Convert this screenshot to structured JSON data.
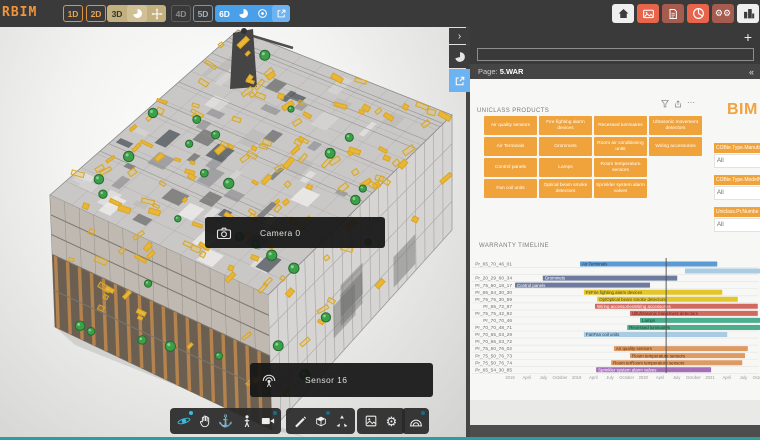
{
  "colors": {
    "accent_orange": "#F0A23B",
    "mode_blue": "#4AA0E8",
    "mode_tan": "#C3B07F",
    "hot_red": "#E8654C",
    "muted_red": "#A55C4E",
    "teal_bottom": "#2F9D9D",
    "active_tool_cyan": "#35BCE0"
  },
  "icons": {
    "plus": "+",
    "collapse": "«",
    "chevron_right": "›",
    "anchor": "⚓",
    "gear": "⚙",
    "more": "⋯"
  },
  "topbar": {
    "logo": "RBIM",
    "modes": {
      "d1": "1D",
      "d2": "2D",
      "d3": "3D",
      "d4": "4D",
      "d5": "5D",
      "d6": "6D"
    },
    "right_icons": [
      "home",
      "images",
      "document",
      "pie-chart",
      "gears",
      "building"
    ]
  },
  "viewport": {
    "tooltips": {
      "camera": "Camera 0",
      "sensor": "Sensor 16"
    },
    "toolbar_icons": [
      "orbit",
      "pan-hand",
      "anchor",
      "walk-person",
      "video-camera",
      "pencil-measure",
      "section-box",
      "explode-model",
      "saved-views",
      "settings-gear",
      "dome-view"
    ]
  },
  "panel": {
    "page_prefix": "Page:",
    "page_name": "5.WAR",
    "report": {
      "uniclass": {
        "title": "UNICLASS PRODUCTS",
        "rows": [
          [
            "Air quality sensors",
            "Fire fighting alarm devices",
            "Recessed luminaires",
            "Ultrasonic movement detectors"
          ],
          [
            "Air Terminals",
            "Grommets",
            "Room air conditioning units",
            "Wiring accessories"
          ],
          [
            "Control panels",
            "Lamps",
            "Room temperature sensors"
          ],
          [
            "Fan coil units",
            "Optical beam smoke detectors",
            "Sprinkler system alarm valves"
          ]
        ]
      },
      "logo": "BIM",
      "filters": [
        {
          "label": "COBie.Type.Manufa",
          "value": "All"
        },
        {
          "label": "COBie.Type.ModelN",
          "value": "All"
        },
        {
          "label": "Uniclass.Pr.Numbe",
          "value": "All"
        }
      ],
      "warranty": {
        "title": "WARRANTY TIMELINE",
        "axis_ticks": [
          "2018",
          "April",
          "July",
          "October",
          "2019",
          "April",
          "July",
          "October",
          "2020",
          "April",
          "July",
          "October",
          "2021",
          "April",
          "July",
          "October"
        ],
        "months_per_tick": 3,
        "today_month": 28.1,
        "rows": [
          {
            "id": "Pr_65_70_46_01",
            "label": "Air Terminals",
            "color": "#5b9bd5",
            "label_color": "#2c3e50",
            "start": 12.6,
            "end": 37.3
          },
          {
            "id": "",
            "label": "",
            "color": "#a9cce3",
            "label_color": "#2c3e50",
            "start": 31.5,
            "end": 45
          },
          {
            "id": "Pr_20_29_60_34",
            "label": "Grommets",
            "color": "#6e7b9e",
            "label_color": "#ffffff",
            "start": 5.9,
            "end": 30.1
          },
          {
            "id": "Pr_75_50_18_17",
            "label": "Control panels",
            "color": "#6e7b9e",
            "label_color": "#ffffff",
            "start": 0.9,
            "end": 25.2
          },
          {
            "id": "Pr_65_54_30_30",
            "label": "FirFire fighting alarm devices",
            "color": "#e3c62c",
            "label_color": "#5a4a10",
            "start": 13.3,
            "end": 38.2
          },
          {
            "id": "Pr_75_75_30_59",
            "label": "OptOptical beam smoke detectors",
            "color": "#e3c62c",
            "label_color": "#5a4a10",
            "start": 15.7,
            "end": 41.0
          },
          {
            "id": "Pr_65_72_97",
            "label": "Wiring accessoriesWiring accessories",
            "color": "#d2695e",
            "label_color": "#ffffff",
            "start": 15.3,
            "end": 44.6
          },
          {
            "id": "Pr_75_75_42_92",
            "label": "UltUltrasonic movement detectors",
            "color": "#d2695e",
            "label_color": "#6e201a",
            "start": 21.6,
            "end": 44.6
          },
          {
            "id": "Pr_70_70_46",
            "label": "Lamps",
            "color": "#4cae8e",
            "label_color": "#17412f",
            "start": 23.4,
            "end": 45
          },
          {
            "id": "Pr_70_70_48_71",
            "label": "Recessed luminaires",
            "color": "#4cae8e",
            "label_color": "#17412f",
            "start": 21.1,
            "end": 45
          },
          {
            "id": "Pr_70_65_03_29",
            "label": "FanFan coil units",
            "color": "#a9cce3",
            "label_color": "#23405a",
            "start": 13.3,
            "end": 39.1
          },
          {
            "id": "Pr_70_65_03_72",
            "label": null,
            "color": null,
            "label_color": null,
            "start": null,
            "end": null
          },
          {
            "id": "Pr_75_50_76_02",
            "label": "Air quality sensors",
            "color": "#dd9a63",
            "label_color": "#5c3413",
            "start": 18.7,
            "end": 42.8
          },
          {
            "id": "Pr_75_50_76_73",
            "label": "Room temperature sensors",
            "color": "#dd9a63",
            "label_color": "#5c3413",
            "start": 21.6,
            "end": 42.3
          },
          {
            "id": "Pr_75_50_76_74",
            "label": "Room terRoom temperature sensors",
            "color": "#dd9a63",
            "label_color": "#5c3413",
            "start": 18.2,
            "end": 41.8
          },
          {
            "id": "Pr_65_54_30_85",
            "label": "Sprinkler system alarm valves",
            "color": "#a46fb8",
            "label_color": "#ffffff",
            "start": 15.5,
            "end": 36.2
          }
        ]
      }
    }
  }
}
